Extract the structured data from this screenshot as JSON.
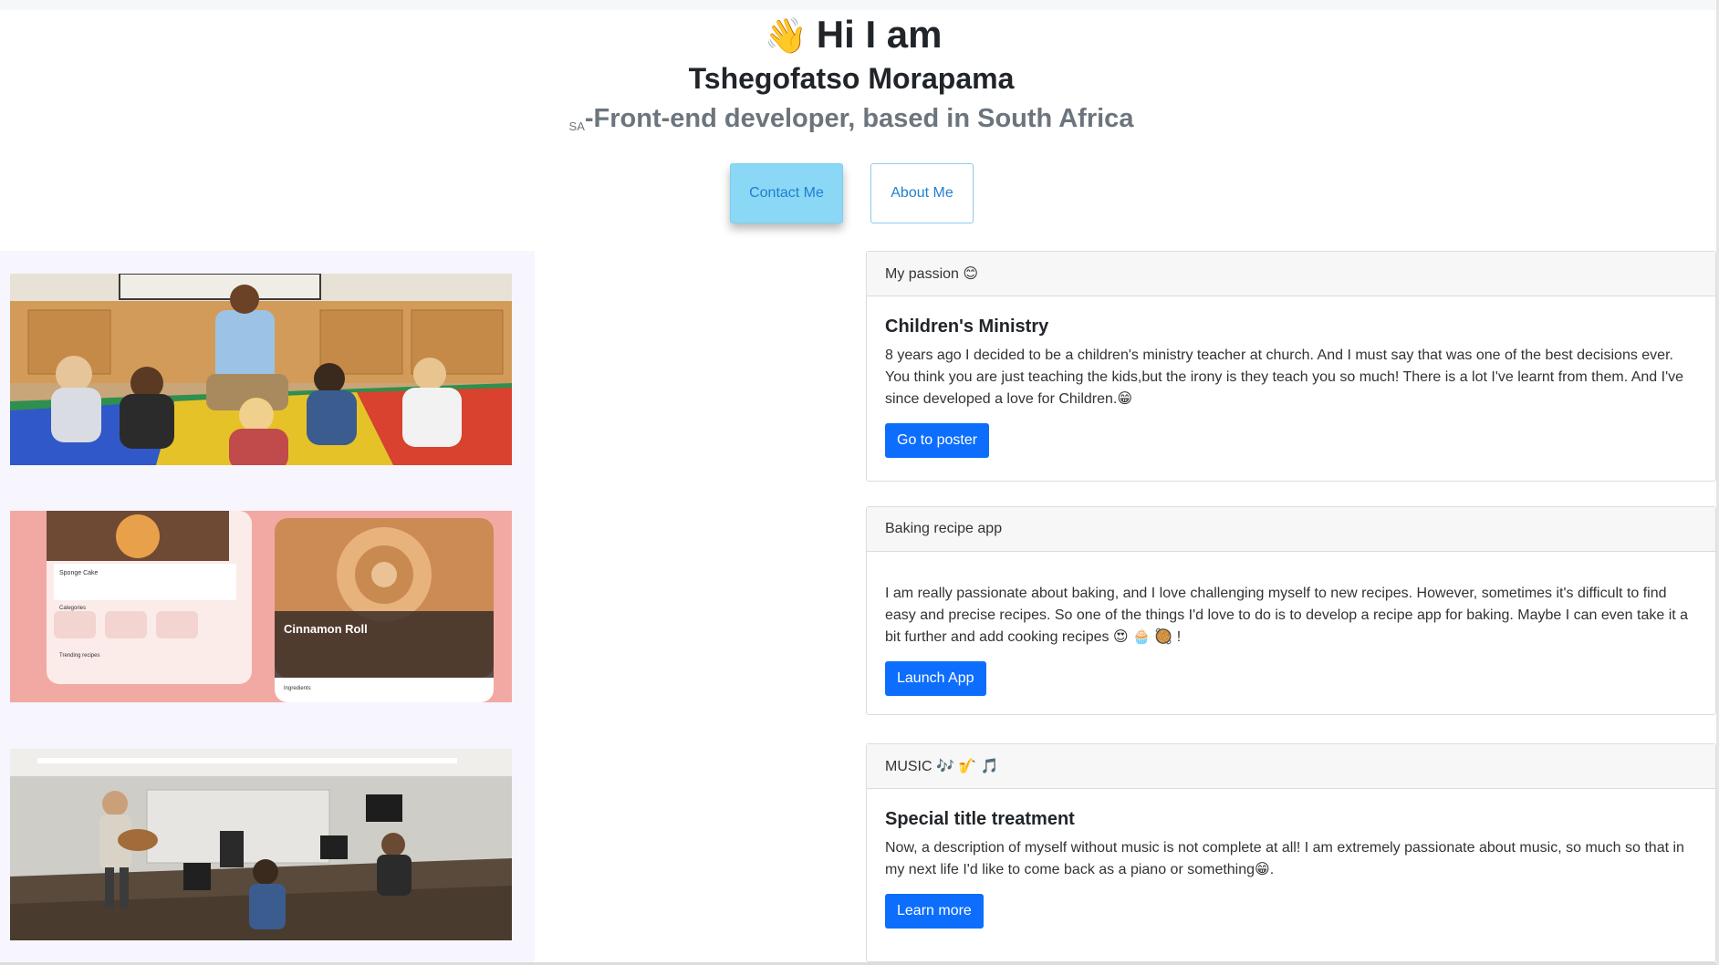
{
  "hero": {
    "wave_icon": "👋",
    "greeting": "Hi I am",
    "name": "Tshegofatso Morapama",
    "role_prefix": "SA",
    "role": "-Front-end developer, based in South Africa",
    "contact_label": "Contact Me",
    "about_label": "About Me"
  },
  "images": [
    {
      "name": "teacher-with-children-photo"
    },
    {
      "name": "baking-recipe-app-mockup"
    },
    {
      "name": "music-class-photo"
    }
  ],
  "recipe_mockup": {
    "left_title": "Sponge Cake",
    "left_categories": "Categories",
    "left_trending": "Trending recipes",
    "right_title": "Cinnamon Roll",
    "right_ingredients": "Ingredients"
  },
  "cards": [
    {
      "header": "My passion 😊",
      "title": "Children's Ministry",
      "text": "8 years ago I decided to be a children's ministry teacher at church. And I must say that was one of the best decisions ever. You think you are just teaching the kids,but the irony is they teach you so much! There is a lot I've learnt from them. And I've since developed a love for Children.😁",
      "button": "Go to poster"
    },
    {
      "header": "Baking recipe app",
      "title": "",
      "text": "I am really passionate about baking, and I love challenging myself to new recipes. However, sometimes it's difficult to find easy and precise recipes. So one of the things I'd love to do is to develop a recipe app for baking. Maybe I can even take it a bit further and add cooking recipes 😍 🧁 🥘 !",
      "button": "Launch App"
    },
    {
      "header": "MUSIC 🎶 🎷 🎵",
      "title": "Special title treatment",
      "text": "Now, a description of myself without music is not complete at all! I am extremely passionate about music, so much so that in my next life I'd like to come back as a piano or something😁.",
      "button": "Learn more"
    }
  ],
  "colors": {
    "primary": "#0d6efd",
    "contact_bg": "#8ad8f5",
    "link_text": "#1f7fd0",
    "left_panel_bg": "#f7f5fd"
  }
}
